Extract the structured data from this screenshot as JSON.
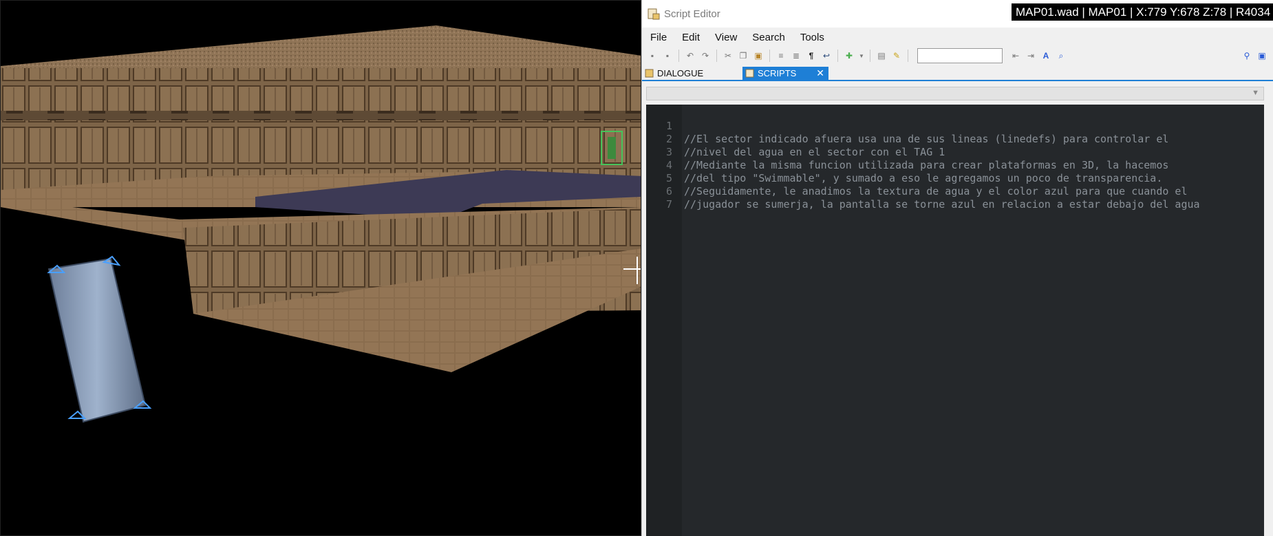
{
  "status_bar": {
    "text": "MAP01.wad | MAP01 | X:779 Y:678 Z:78 | R4034"
  },
  "viewport": {
    "colors": {
      "background": "#000000",
      "wall": "#7d6448",
      "floor": "#8a6d4e",
      "ceiling": "#8f7456",
      "water": "#3d3a55",
      "pillar": "#7f94b3",
      "handle": "#4aa0ff"
    },
    "icons": [
      "thing-marker-icon",
      "crosshair-icon"
    ]
  },
  "editor": {
    "title": "Script Editor",
    "title_icon": "script-editor-icon",
    "menu": [
      "File",
      "Edit",
      "View",
      "Search",
      "Tools"
    ],
    "toolbar": {
      "icons": [
        "save-icon",
        "save-all-icon",
        "undo-icon",
        "redo-icon",
        "cut-icon",
        "copy-icon",
        "paste-icon",
        "indent-icon",
        "outdent-icon",
        "whitespace-icon",
        "wordwrap-icon",
        "snippet-icon",
        "compile-icon",
        "check-icon",
        "find-previous-icon",
        "find-next-icon",
        "match-case-icon",
        "find-replace-icon",
        "search-icon",
        "script-lump-icon"
      ],
      "search_value": ""
    },
    "tabs": [
      {
        "label": "DIALOGUE",
        "active": false
      },
      {
        "label": "SCRIPTS",
        "active": true
      }
    ],
    "script_selector": {
      "value": ""
    },
    "code_lines": [
      {
        "num": "1",
        "text": "//El sector indicado afuera usa una de sus lineas (linedefs) para controlar el"
      },
      {
        "num": "2",
        "text": "//nivel del agua en el sector con el TAG 1"
      },
      {
        "num": "3",
        "text": "//Mediante la misma funcion utilizada para crear plataformas en 3D, la hacemos"
      },
      {
        "num": "4",
        "text": "//del tipo \"Swimmable\", y sumado a eso le agregamos un poco de transparencia."
      },
      {
        "num": "5",
        "text": "//Seguidamente, le anadimos la textura de agua y el color azul para que cuando el"
      },
      {
        "num": "6",
        "text": "//jugador se sumerja, la pantalla se torne azul en relacion a estar debajo del agua"
      },
      {
        "num": "7",
        "text": ""
      }
    ],
    "colors": {
      "accent": "#1e7fd6",
      "code_bg": "#25282b",
      "code_text": "#8a9198",
      "gutter_text": "#6a6f73"
    }
  }
}
